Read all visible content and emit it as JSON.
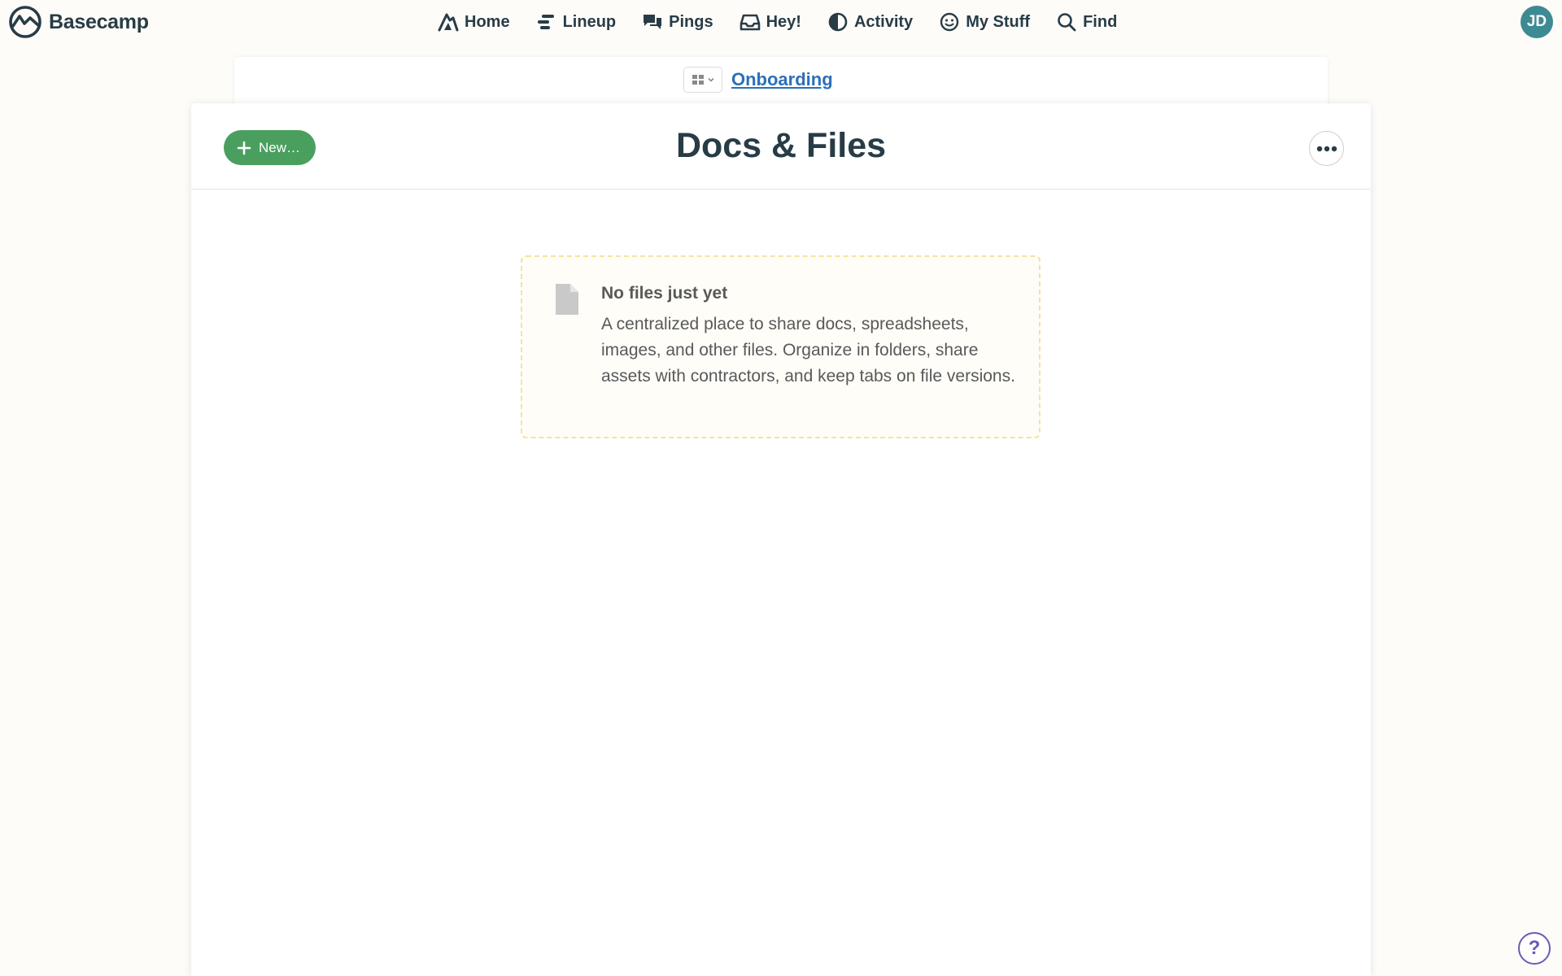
{
  "brand": {
    "name": "Basecamp"
  },
  "nav": {
    "items": [
      {
        "label": "Home",
        "icon": "home-icon"
      },
      {
        "label": "Lineup",
        "icon": "lineup-icon"
      },
      {
        "label": "Pings",
        "icon": "pings-icon"
      },
      {
        "label": "Hey!",
        "icon": "inbox-icon"
      },
      {
        "label": "Activity",
        "icon": "activity-icon"
      },
      {
        "label": "My Stuff",
        "icon": "smiley-icon"
      },
      {
        "label": "Find",
        "icon": "search-icon"
      }
    ]
  },
  "user": {
    "initials": "JD",
    "avatar_color": "#3d8a93"
  },
  "breadcrumb": {
    "project": "Onboarding"
  },
  "page": {
    "title": "Docs & Files",
    "new_label": "New…",
    "accent_color": "#4a9f5f"
  },
  "empty_state": {
    "title": "No files just yet",
    "body": "A centralized place to share docs, spreadsheets, images, and other files. Organize in folders, share assets with contractors, and keep tabs on file versions."
  },
  "help": {
    "label": "?"
  }
}
